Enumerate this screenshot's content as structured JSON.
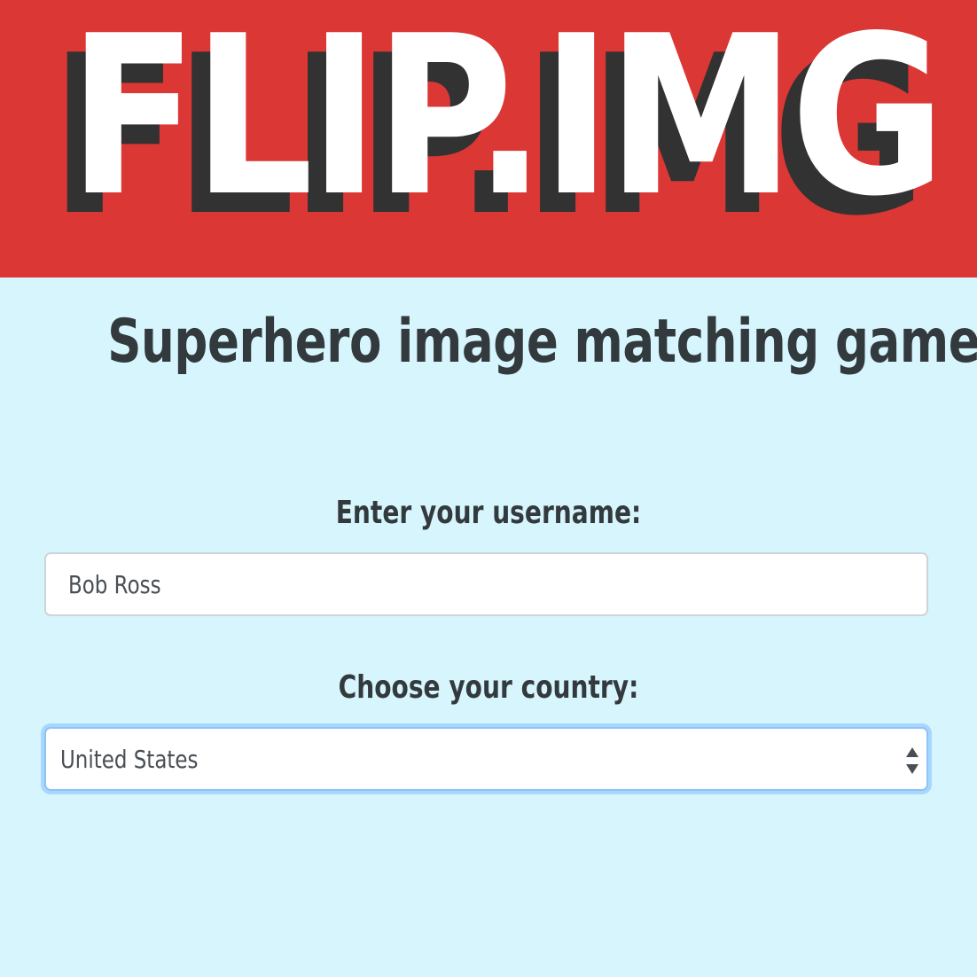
{
  "logo": {
    "text": "FLIP.IMG"
  },
  "subtitle": "Superhero image matching game",
  "form": {
    "username_label": "Enter your username:",
    "username_value": "Bob Ross",
    "country_label": "Choose your country:",
    "country_value": "United States"
  },
  "icons": {
    "select_arrows": "up-down-chevron-icon"
  },
  "colors": {
    "banner": "#db3734",
    "background": "#d7f5fd",
    "logo_front": "#ffffff",
    "logo_shadow": "#323232",
    "text": "#333a3d",
    "focus_ring": "#80bdff"
  }
}
